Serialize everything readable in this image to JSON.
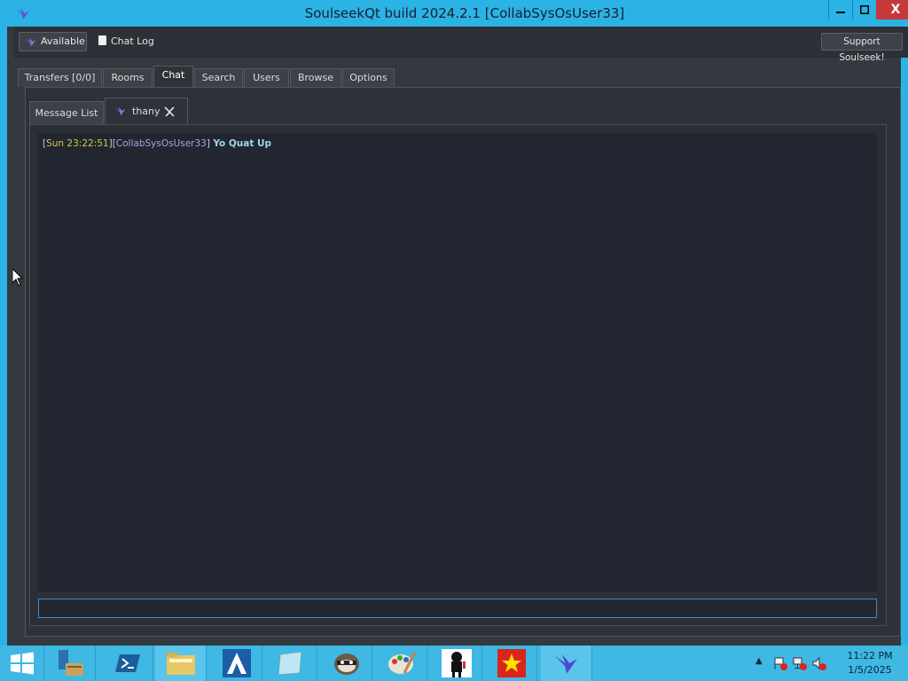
{
  "window": {
    "title": "SoulseekQt build 2024.2.1 [CollabSysOsUser33]",
    "controls": {
      "minimize": "▁",
      "maximize": "□",
      "close": "X"
    }
  },
  "toolbar": {
    "status_label": "Available",
    "chat_log_label": "Chat Log",
    "support_label": "Support Soulseek!"
  },
  "main_tabs": [
    "Transfers [0/0]",
    "Rooms",
    "Chat",
    "Search",
    "Users",
    "Browse",
    "Options"
  ],
  "active_main_tab": "Chat",
  "chat": {
    "sub_tabs": {
      "message_list": "Message List",
      "user": "thany"
    },
    "messages": [
      {
        "time": "Sun 23:22:51",
        "user": "CollabSysOsUser33",
        "text": "Yo Quat Up"
      }
    ],
    "input_value": ""
  },
  "taskbar": {
    "clock_time": "11:22 PM",
    "clock_date": "1/5/2025"
  },
  "colors": {
    "title_bar": "#2bb3e6",
    "close_button": "#c7383a",
    "chat_bg": "#222630",
    "timestamp": "#d6c84a",
    "username": "#b79be6",
    "message": "#9ed6ea"
  }
}
